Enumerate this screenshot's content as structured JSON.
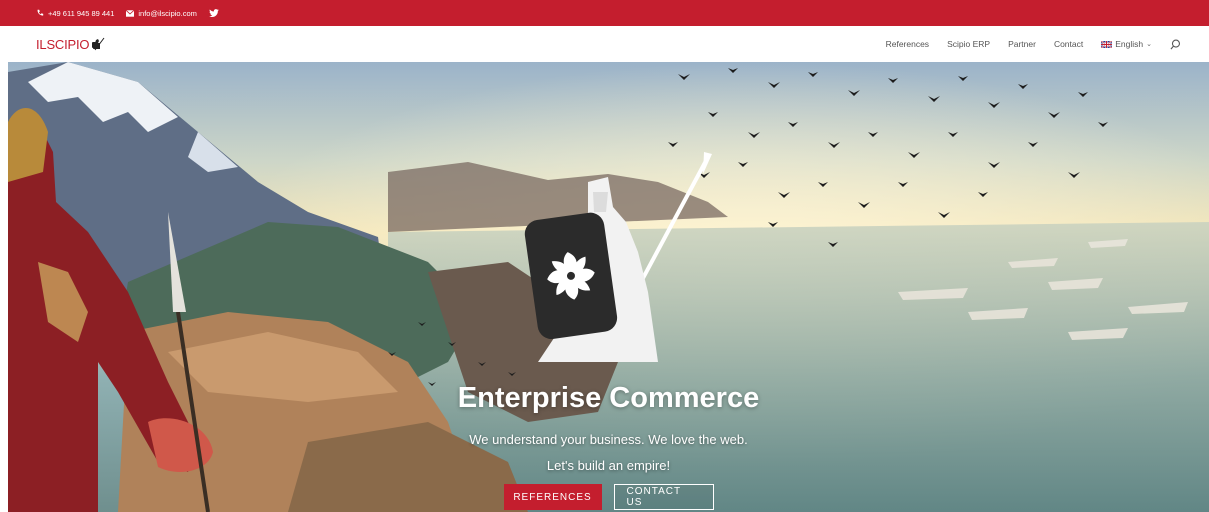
{
  "colors": {
    "brand": "#c41e2e",
    "white": "#ffffff"
  },
  "topbar": {
    "phone": "+49 611 945 89 441",
    "email": "info@ilscipio.com",
    "icons": [
      "phone-icon",
      "mail-icon",
      "twitter-icon"
    ]
  },
  "header": {
    "logo_text": "ILSCIPIO",
    "nav": {
      "references": "References",
      "scipio_erp": "Scipio ERP",
      "partner": "Partner",
      "contact": "Contact",
      "language": "English"
    },
    "icons": [
      "uk-flag-icon",
      "chevron-down-icon",
      "search-icon"
    ]
  },
  "hero": {
    "title": "Enterprise Commerce",
    "subtitle1": "We understand your business. We love the web.",
    "subtitle2": "Let's build an empire!",
    "primary_button": "REFERENCES",
    "secondary_button": "CONTACT US"
  }
}
